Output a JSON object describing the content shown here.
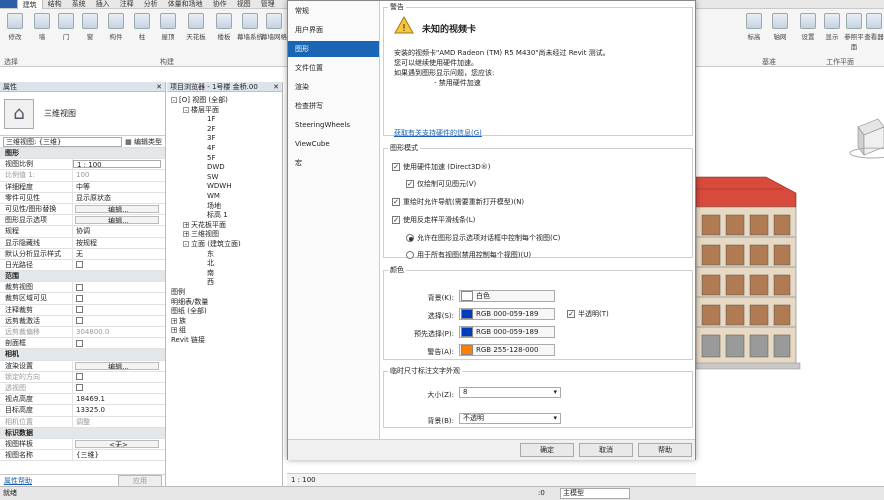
{
  "ribbon": {
    "tabs": [
      "建筑",
      "结构",
      "系统",
      "插入",
      "注释",
      "分析",
      "体量和场地",
      "协作",
      "视图",
      "管理"
    ],
    "buttons": [
      "修改",
      "墙",
      "门",
      "窗",
      "构件",
      "柱",
      "屋顶",
      "天花板",
      "楼板",
      "幕墙系统",
      "幕墙网格"
    ],
    "right_buttons": [
      "标高",
      "轴网",
      "设置",
      "显示",
      "参照平面",
      "查看器"
    ],
    "groups": [
      "选择",
      "构建",
      "基准",
      "工作平面"
    ]
  },
  "properties": {
    "title": "属性",
    "type_name": "三维视图",
    "selector": "三维视图: {三维}",
    "edit_type": "编辑类型",
    "groups": {
      "graphics": "图形",
      "extents": "范围",
      "camera": "相机",
      "identity": "标识数据"
    },
    "rows_graphics": [
      {
        "k": "视图比例",
        "v": "1 : 100",
        "kind": "input"
      },
      {
        "k": "比例值 1:",
        "v": "100",
        "kind": "dim"
      },
      {
        "k": "详细程度",
        "v": "中等"
      },
      {
        "k": "零件可见性",
        "v": "显示原状态"
      },
      {
        "k": "可见性/图形替换",
        "v": "编辑...",
        "kind": "btn"
      },
      {
        "k": "图形显示选项",
        "v": "编辑...",
        "kind": "btn"
      },
      {
        "k": "规程",
        "v": "协调"
      },
      {
        "k": "显示隐藏线",
        "v": "按规程"
      },
      {
        "k": "默认分析显示样式",
        "v": "无"
      },
      {
        "k": "日光路径",
        "v": "",
        "kind": "cb"
      }
    ],
    "rows_extents": [
      {
        "k": "裁剪视图",
        "v": "",
        "kind": "cb"
      },
      {
        "k": "裁剪区域可见",
        "v": "",
        "kind": "cb"
      },
      {
        "k": "注释裁剪",
        "v": "",
        "kind": "cb"
      },
      {
        "k": "远剪裁激活",
        "v": "",
        "kind": "cb"
      },
      {
        "k": "远剪裁偏移",
        "v": "304800.0",
        "kind": "dim"
      },
      {
        "k": "剖面框",
        "v": "",
        "kind": "cb"
      }
    ],
    "rows_camera": [
      {
        "k": "渲染设置",
        "v": "编辑...",
        "kind": "btn"
      },
      {
        "k": "锁定的方向",
        "v": "",
        "kind": "dimcb"
      },
      {
        "k": "透视图",
        "v": "",
        "kind": "dimcb"
      },
      {
        "k": "视点高度",
        "v": "18469.1"
      },
      {
        "k": "目标高度",
        "v": "13325.0"
      },
      {
        "k": "相机位置",
        "v": "调整",
        "kind": "dim"
      }
    ],
    "rows_identity": [
      {
        "k": "视图样板",
        "v": "<无>",
        "kind": "btn"
      },
      {
        "k": "视图名称",
        "v": "{三维}"
      }
    ],
    "help_link": "属性帮助",
    "apply": "应用"
  },
  "browser": {
    "title": "项目浏览器 - 1号楼 金桥.00",
    "items": [
      {
        "t": "[O] 视图 (全部)",
        "lvl": 0,
        "tg": "-"
      },
      {
        "t": "楼层平面",
        "lvl": 1,
        "tg": "-"
      },
      {
        "t": "1F",
        "lvl": 3
      },
      {
        "t": "2F",
        "lvl": 3
      },
      {
        "t": "3F",
        "lvl": 3
      },
      {
        "t": "4F",
        "lvl": 3
      },
      {
        "t": "5F",
        "lvl": 3
      },
      {
        "t": "DWD",
        "lvl": 3
      },
      {
        "t": "SW",
        "lvl": 3
      },
      {
        "t": "WDWH",
        "lvl": 3
      },
      {
        "t": "WM",
        "lvl": 3
      },
      {
        "t": "场地",
        "lvl": 3
      },
      {
        "t": "标高 1",
        "lvl": 3
      },
      {
        "t": "天花板平面",
        "lvl": 1,
        "tg": "+"
      },
      {
        "t": "三维视图",
        "lvl": 1,
        "tg": "+"
      },
      {
        "t": "立面 (建筑立面)",
        "lvl": 1,
        "tg": "-"
      },
      {
        "t": "东",
        "lvl": 3
      },
      {
        "t": "北",
        "lvl": 3
      },
      {
        "t": "南",
        "lvl": 3
      },
      {
        "t": "西",
        "lvl": 3
      },
      {
        "t": "图例",
        "lvl": 0
      },
      {
        "t": "明细表/数量",
        "lvl": 0
      },
      {
        "t": "图纸 (全部)",
        "lvl": 0
      },
      {
        "t": "族",
        "lvl": 0,
        "tg": "+"
      },
      {
        "t": "组",
        "lvl": 0,
        "tg": "+"
      },
      {
        "t": "Revit 链接",
        "lvl": 0
      }
    ]
  },
  "dialog": {
    "nav": [
      "常规",
      "用户界面",
      "图形",
      "文件位置",
      "渲染",
      "检查拼写",
      "SteeringWheels",
      "ViewCube",
      "宏"
    ],
    "active_nav": 2,
    "warning": {
      "legend": "警告",
      "title": "未知的视频卡",
      "line1": "安装的视频卡\"AMD Radeon (TM) R5 M430\"尚未经过 Revit 测试。",
      "line2": "您可以继续使用硬件加速。",
      "line3": "如果遇到图形显示问题，您应该:",
      "line4": "- 禁用硬件加速",
      "link": "获取有关支持硬件的信息(G)"
    },
    "graphics_mode": {
      "legend": "图形模式",
      "use_hw": "使用硬件加速 (Direct3D®)",
      "draw_visible": "仅绘制可见图元(V)",
      "redraw_nav": "重绘时允许导航(需要重新打开模型)(N)",
      "antialias": "使用反走样平滑线条(L)",
      "allow_view": "允许在图形显示选项对话框中控制每个视图(C)",
      "all_views": "用于所有视图(禁用控制每个视图)(U)"
    },
    "colors": {
      "legend": "颜色",
      "background_label": "背景(K):",
      "background_value": "白色",
      "background_hex": "#ffffff",
      "selection_label": "选择(S):",
      "selection_value": "RGB 000-059-189",
      "selection_hex": "#003bbd",
      "semi_transparent": "半透明(T)",
      "preselection_label": "预先选择(P):",
      "preselection_value": "RGB 000-059-189",
      "preselection_hex": "#003bbd",
      "alert_label": "警告(A):",
      "alert_value": "RGB 255-128-000",
      "alert_hex": "#ff8000"
    },
    "temp_dim": {
      "legend": "临时尺寸标注文字外观",
      "size_label": "大小(Z):",
      "size_value": "8",
      "bg_label": "背景(B):",
      "bg_value": "不透明"
    },
    "buttons": {
      "ok": "确定",
      "cancel": "取消",
      "help": "帮助"
    }
  },
  "viewbar": {
    "scale": "1 : 100"
  },
  "status": {
    "left": "就绪",
    "model": "主模型",
    "count": ":0"
  }
}
